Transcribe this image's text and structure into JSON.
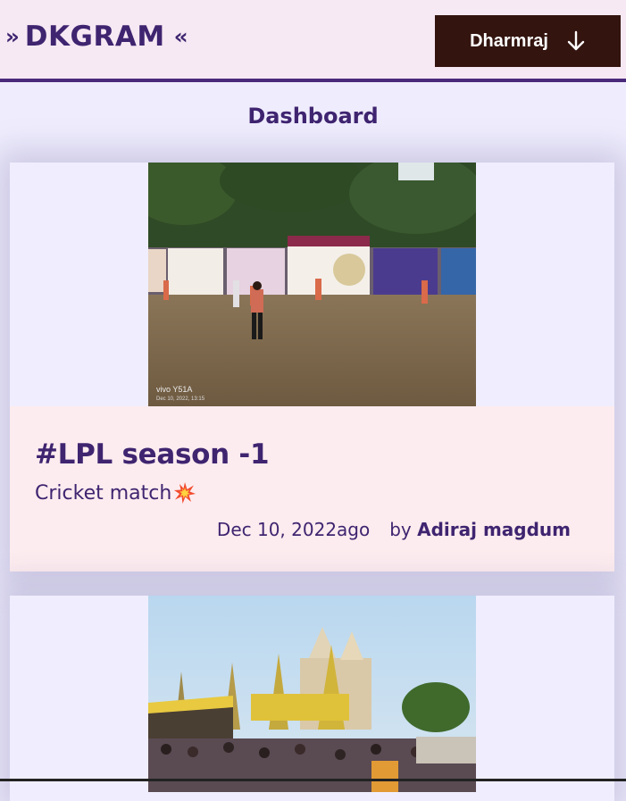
{
  "header": {
    "logo_left": "›› ",
    "logo_text": "DKGRAM",
    "logo_right": "‹‹",
    "user_button_label": "Dharmraj",
    "user_button_icon": "arrow-down-icon"
  },
  "page": {
    "title": "Dashboard"
  },
  "posts": [
    {
      "title": "#LPL season -1",
      "description": "Cricket match",
      "description_icon": "collision-emoji-icon",
      "date": "Dec 10, 2022ago",
      "by_label": "by",
      "author": "Adiraj magdum",
      "photo_watermark_brand": "vivo Y51A",
      "photo_watermark_date": "Dec 10, 2022, 13:15"
    },
    {
      "title": "",
      "description": "",
      "date": "",
      "author": ""
    }
  ],
  "colors": {
    "accent": "#3f2470",
    "header_bg": "#f6e9f3",
    "user_button_bg": "#33140f",
    "card_body_bg": "#fcecef",
    "page_bg": "#efedfd"
  }
}
